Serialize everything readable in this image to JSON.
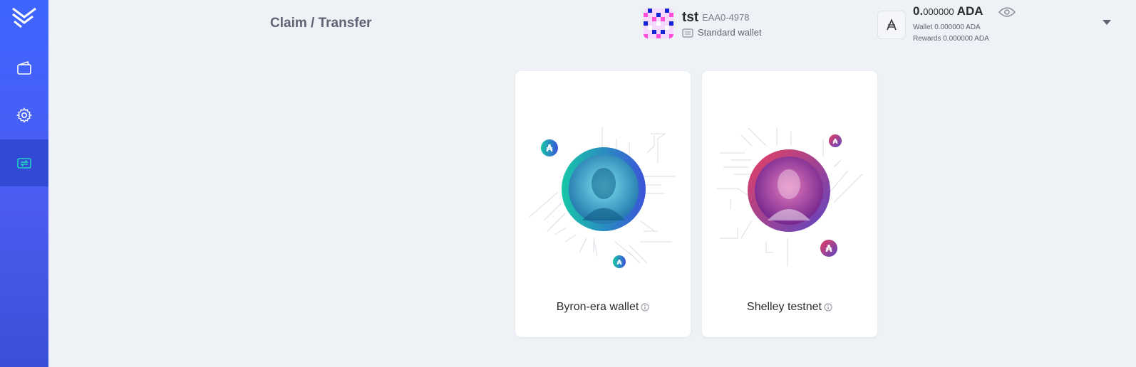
{
  "header": {
    "title": "Claim / Transfer",
    "wallet": {
      "name": "tst",
      "plate_id": "EAA0-4978",
      "type": "Standard wallet"
    },
    "balance": {
      "int": "0.",
      "dec": "000000",
      "unit": "ADA",
      "wallet_label": "Wallet",
      "wallet_value": "0.000000 ADA",
      "rewards_label": "Rewards",
      "rewards_value": "0.000000 ADA"
    }
  },
  "sidebar": {
    "items": [
      {
        "name": "wallets",
        "icon": "wallet-icon"
      },
      {
        "name": "settings",
        "icon": "gear-icon"
      },
      {
        "name": "transfer",
        "icon": "transfer-icon",
        "active": true
      }
    ]
  },
  "cards": [
    {
      "label": "Byron-era wallet",
      "accent": [
        "#17c6a7",
        "#3b54d9"
      ]
    },
    {
      "label": "Shelley testnet",
      "accent": [
        "#e8405f",
        "#5b45c4"
      ]
    }
  ],
  "colors": {
    "sidebar": "#3e64ff",
    "background": "#eef1f5"
  }
}
